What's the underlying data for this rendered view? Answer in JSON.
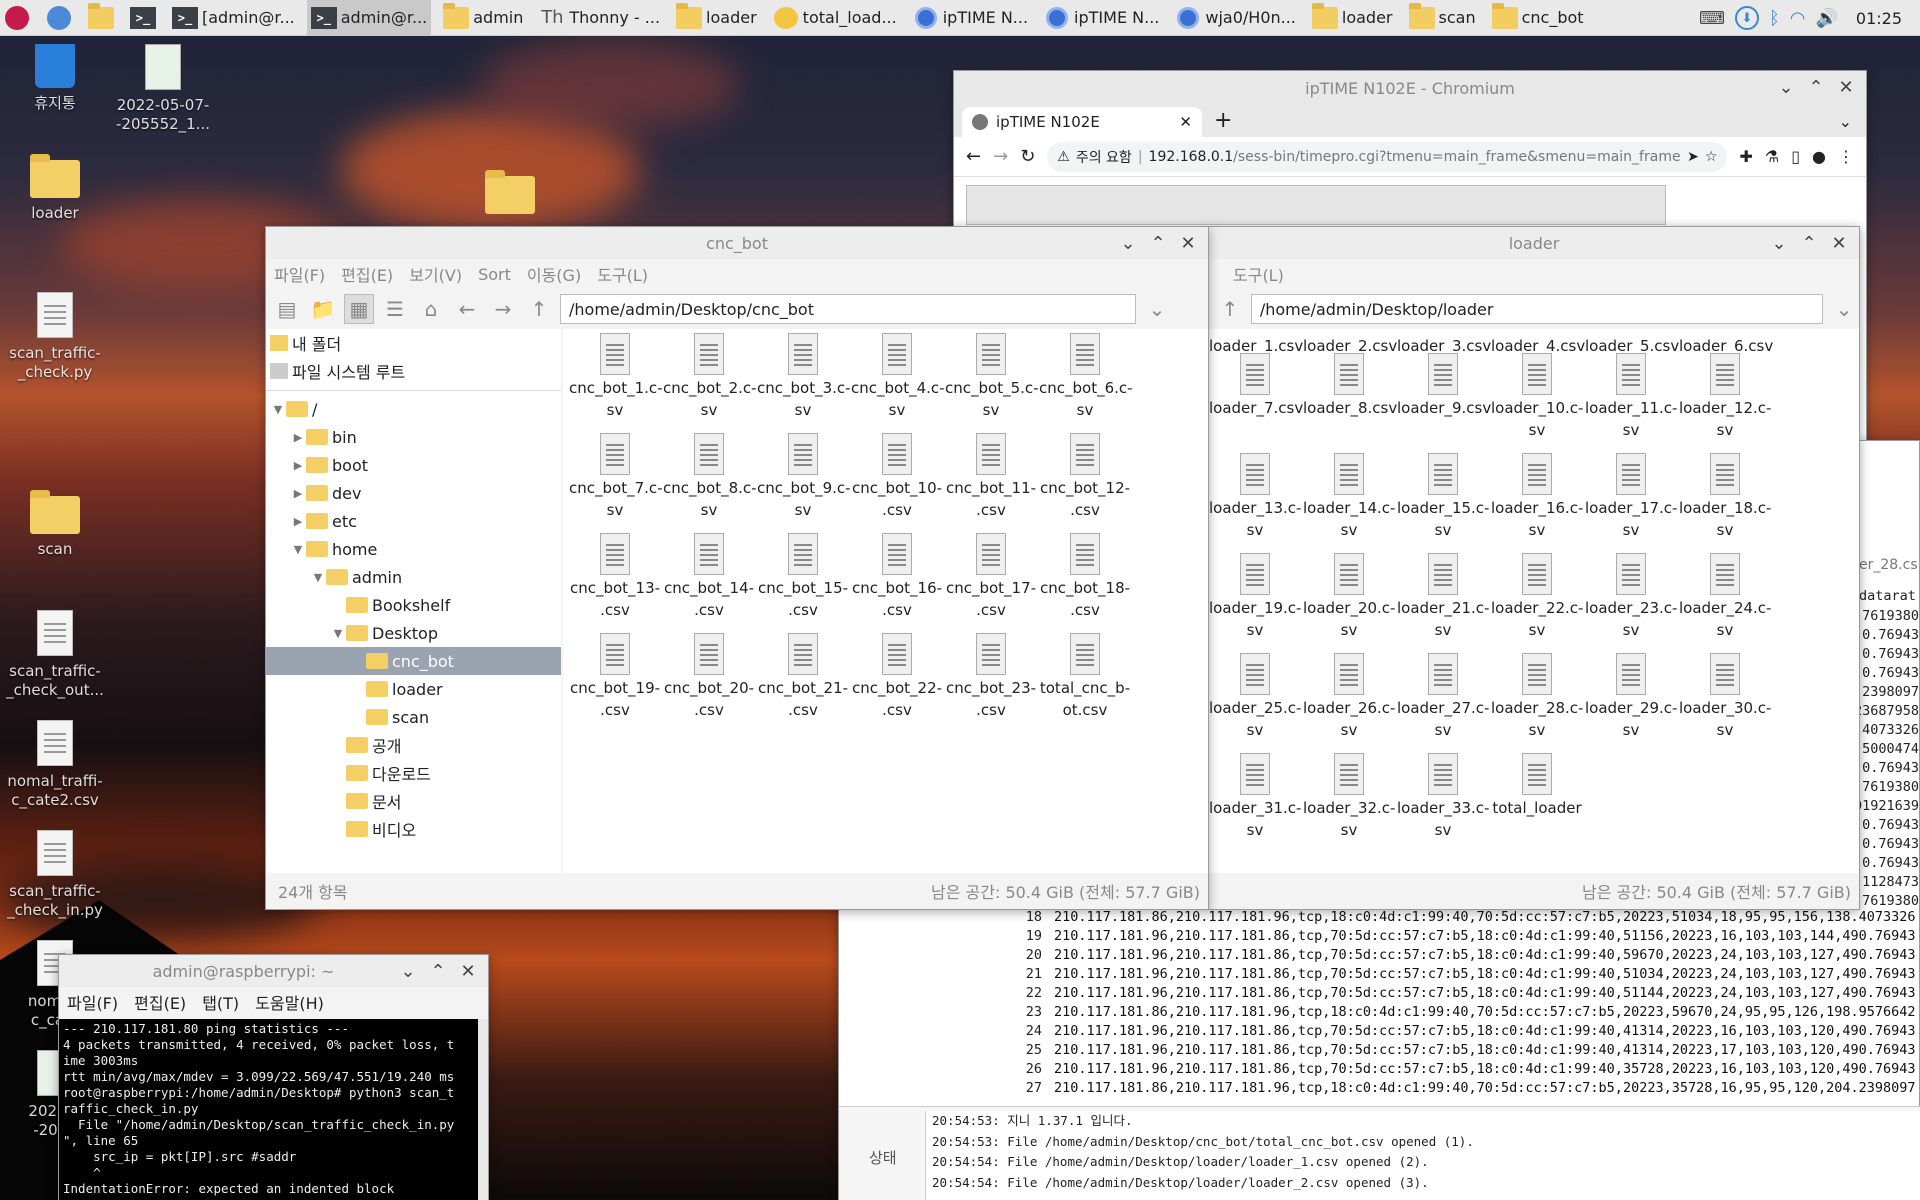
{
  "taskbar": {
    "items": [
      {
        "label": "",
        "icon": "raspberry-icon"
      },
      {
        "label": "",
        "icon": "globe-icon"
      },
      {
        "label": "",
        "icon": "folder-icon"
      },
      {
        "label": "",
        "icon": "terminal-icon"
      },
      {
        "label": "[admin@r...",
        "icon": "terminal-icon"
      },
      {
        "label": "admin@r...",
        "icon": "terminal-icon"
      },
      {
        "label": "admin",
        "icon": "folder-icon"
      },
      {
        "label": "Thonny - ...",
        "icon": "thonny-icon"
      },
      {
        "label": "loader",
        "icon": "folder-icon"
      },
      {
        "label": "total_load...",
        "icon": "wireshark-icon"
      },
      {
        "label": "ipTIME N...",
        "icon": "chromium-icon"
      },
      {
        "label": "ipTIME N...",
        "icon": "chromium-icon"
      },
      {
        "label": "wja0/H0n...",
        "icon": "chromium-icon"
      },
      {
        "label": "loader",
        "icon": "folder-icon"
      },
      {
        "label": "scan",
        "icon": "folder-icon"
      },
      {
        "label": "cnc_bot",
        "icon": "folder-icon"
      }
    ],
    "clock": "01:25"
  },
  "desktop": {
    "icons": [
      {
        "label": "휴지통",
        "kind": "trash"
      },
      {
        "label": "2022-05-07-\n-205552_1...",
        "kind": "image"
      },
      {
        "label": "loader",
        "kind": "folder"
      },
      {
        "label": "scan_traffic-\n_check.py",
        "kind": "doc"
      },
      {
        "label": "scan",
        "kind": "folder"
      },
      {
        "label": "scan_traffic-\n_check_out...",
        "kind": "doc"
      },
      {
        "label": "nomal_traffi-\nc_cate2.csv",
        "kind": "doc"
      },
      {
        "label": "scan_traffic-\n_check_in.py",
        "kind": "doc"
      },
      {
        "label": "nomal_\nc_cate",
        "kind": "doc"
      },
      {
        "label": "2022-0\n-2025",
        "kind": "image"
      }
    ]
  },
  "chromium": {
    "title": "ipTIME N102E - Chromium",
    "tab": "ipTIME N102E",
    "security": "주의 요함",
    "url_host": "192.168.0.1",
    "url_path": "/sess-bin/timepro.cgi?tmenu=main_frame&smenu=main_frame"
  },
  "cnc_window": {
    "title": "cnc_bot",
    "menu": [
      "파일(F)",
      "편집(E)",
      "보기(V)",
      "Sort",
      "이동(G)",
      "도구(L)"
    ],
    "path": "/home/admin/Desktop/cnc_bot",
    "places": [
      "내 폴더",
      "파일 시스템 루트"
    ],
    "tree": [
      {
        "label": "/",
        "depth": 0,
        "arrow": "▼"
      },
      {
        "label": "bin",
        "depth": 1,
        "arrow": "▶"
      },
      {
        "label": "boot",
        "depth": 1,
        "arrow": "▶"
      },
      {
        "label": "dev",
        "depth": 1,
        "arrow": "▶"
      },
      {
        "label": "etc",
        "depth": 1,
        "arrow": "▶"
      },
      {
        "label": "home",
        "depth": 1,
        "arrow": "▼"
      },
      {
        "label": "admin",
        "depth": 2,
        "arrow": "▼"
      },
      {
        "label": "Bookshelf",
        "depth": 3,
        "arrow": ""
      },
      {
        "label": "Desktop",
        "depth": 3,
        "arrow": "▼"
      },
      {
        "label": "cnc_bot",
        "depth": 4,
        "arrow": "",
        "selected": true
      },
      {
        "label": "loader",
        "depth": 4,
        "arrow": ""
      },
      {
        "label": "scan",
        "depth": 4,
        "arrow": ""
      },
      {
        "label": "공개",
        "depth": 3,
        "arrow": ""
      },
      {
        "label": "다운로드",
        "depth": 3,
        "arrow": ""
      },
      {
        "label": "문서",
        "depth": 3,
        "arrow": ""
      },
      {
        "label": "비디오",
        "depth": 3,
        "arrow": ""
      }
    ],
    "files": [
      "cnc_bot_1.c-\nsv",
      "cnc_bot_2.c-\nsv",
      "cnc_bot_3.c-\nsv",
      "cnc_bot_4.c-\nsv",
      "cnc_bot_5.c-\nsv",
      "cnc_bot_6.c-\nsv",
      "cnc_bot_7.c-\nsv",
      "cnc_bot_8.c-\nsv",
      "cnc_bot_9.c-\nsv",
      "cnc_bot_10-\n.csv",
      "cnc_bot_11-\n.csv",
      "cnc_bot_12-\n.csv",
      "cnc_bot_13-\n.csv",
      "cnc_bot_14-\n.csv",
      "cnc_bot_15-\n.csv",
      "cnc_bot_16-\n.csv",
      "cnc_bot_17-\n.csv",
      "cnc_bot_18-\n.csv",
      "cnc_bot_19-\n.csv",
      "cnc_bot_20-\n.csv",
      "cnc_bot_21-\n.csv",
      "cnc_bot_22-\n.csv",
      "cnc_bot_23-\n.csv",
      "total_cnc_b-\not.csv"
    ],
    "status_left": "24개 항목",
    "status_right": "남은 공간: 50.4 GiB (전체: 57.7 GiB)"
  },
  "loader_window": {
    "title": "loader",
    "menu": [
      "도구(L)"
    ],
    "path": "/home/admin/Desktop/loader",
    "header_files": [
      "loader_1.csv",
      "loader_2.csv",
      "loader_3.csv",
      "loader_4.csv",
      "loader_5.csv",
      "loader_6.csv"
    ],
    "files": [
      "loader_7.csv",
      "loader_8.csv",
      "loader_9.csv",
      "loader_10.c-\nsv",
      "loader_11.c-\nsv",
      "loader_12.c-\nsv",
      "loader_13.c-\nsv",
      "loader_14.c-\nsv",
      "loader_15.c-\nsv",
      "loader_16.c-\nsv",
      "loader_17.c-\nsv",
      "loader_18.c-\nsv",
      "loader_19.c-\nsv",
      "loader_20.c-\nsv",
      "loader_21.c-\nsv",
      "loader_22.c-\nsv",
      "loader_23.c-\nsv",
      "loader_24.c-\nsv",
      "loader_25.c-\nsv",
      "loader_26.c-\nsv",
      "loader_27.c-\nsv",
      "loader_28.c-\nsv",
      "loader_29.c-\nsv",
      "loader_30.c-\nsv",
      "loader_31.c-\nsv",
      "loader_32.c-\nsv",
      "loader_33.c-\nsv",
      "total_loader"
    ],
    "status_right": "남은 공간: 50.4 GiB (전체: 57.7 GiB)"
  },
  "terminal": {
    "title": "admin@raspberrypi: ~",
    "menu": [
      "파일(F)",
      "편집(E)",
      "탭(T)",
      "도움말(H)"
    ],
    "lines": [
      "--- 210.117.181.80 ping statistics ---",
      "4 packets transmitted, 4 received, 0% packet loss, t",
      "ime 3003ms",
      "rtt min/avg/max/mdev = 3.099/22.569/47.551/19.240 ms",
      "root@raspberrypi:/home/admin/Desktop# python3 scan_t",
      "raffic_check_in.py",
      "  File \"/home/admin/Desktop/scan_traffic_check_in.py",
      "\", line 65",
      "    src_ip = pkt[IP].src #saddr",
      "    ^",
      "IndentationError: expected an indented block"
    ]
  },
  "wireshark": {
    "side_title": "er_28.cs",
    "col_header": "datarat",
    "right_vals": [
      ".7619380",
      "0.76943",
      "0.76943",
      "0.76943",
      ".2398097",
      "23687958",
      "4073326",
      ".5000474",
      "0.76943",
      ".7619380",
      "01921639",
      "0.76943",
      "0.76943",
      "0.76943",
      "1128473",
      ".7619380"
    ],
    "rows": [
      {
        "n": "18",
        "t": "210.117.181.86,210.117.181.96,tcp,18:c0:4d:c1:99:40,70:5d:cc:57:c7:b5,20223,51034,18,95,95,156,138.4073326"
      },
      {
        "n": "19",
        "t": "210.117.181.96,210.117.181.86,tcp,70:5d:cc:57:c7:b5,18:c0:4d:c1:99:40,51156,20223,16,103,103,144,490.76943"
      },
      {
        "n": "20",
        "t": "210.117.181.96,210.117.181.86,tcp,70:5d:cc:57:c7:b5,18:c0:4d:c1:99:40,59670,20223,24,103,103,127,490.76943"
      },
      {
        "n": "21",
        "t": "210.117.181.96,210.117.181.86,tcp,70:5d:cc:57:c7:b5,18:c0:4d:c1:99:40,51034,20223,24,103,103,127,490.76943"
      },
      {
        "n": "22",
        "t": "210.117.181.96,210.117.181.86,tcp,70:5d:cc:57:c7:b5,18:c0:4d:c1:99:40,51144,20223,24,103,103,127,490.76943"
      },
      {
        "n": "23",
        "t": "210.117.181.86,210.117.181.96,tcp,18:c0:4d:c1:99:40,70:5d:cc:57:c7:b5,20223,59670,24,95,95,126,198.9576642"
      },
      {
        "n": "24",
        "t": "210.117.181.96,210.117.181.86,tcp,70:5d:cc:57:c7:b5,18:c0:4d:c1:99:40,41314,20223,16,103,103,120,490.76943"
      },
      {
        "n": "25",
        "t": "210.117.181.96,210.117.181.86,tcp,70:5d:cc:57:c7:b5,18:c0:4d:c1:99:40,41314,20223,17,103,103,120,490.76943"
      },
      {
        "n": "26",
        "t": "210.117.181.96,210.117.181.86,tcp,70:5d:cc:57:c7:b5,18:c0:4d:c1:99:40,35728,20223,16,103,103,120,490.76943"
      },
      {
        "n": "27",
        "t": "210.117.181.86,210.117.181.96,tcp,18:c0:4d:c1:99:40,70:5d:cc:57:c7:b5,20223,35728,16,95,95,120,204.2398097"
      }
    ],
    "status_label": "상태",
    "log": [
      "20:54:53: 지니 1.37.1 입니다.",
      "20:54:53: File /home/admin/Desktop/cnc_bot/total_cnc_bot.csv opened (1).",
      "20:54:54: File /home/admin/Desktop/loader/loader_1.csv opened (2).",
      "20:54:54: File /home/admin/Desktop/loader/loader_2.csv opened (3)."
    ]
  }
}
